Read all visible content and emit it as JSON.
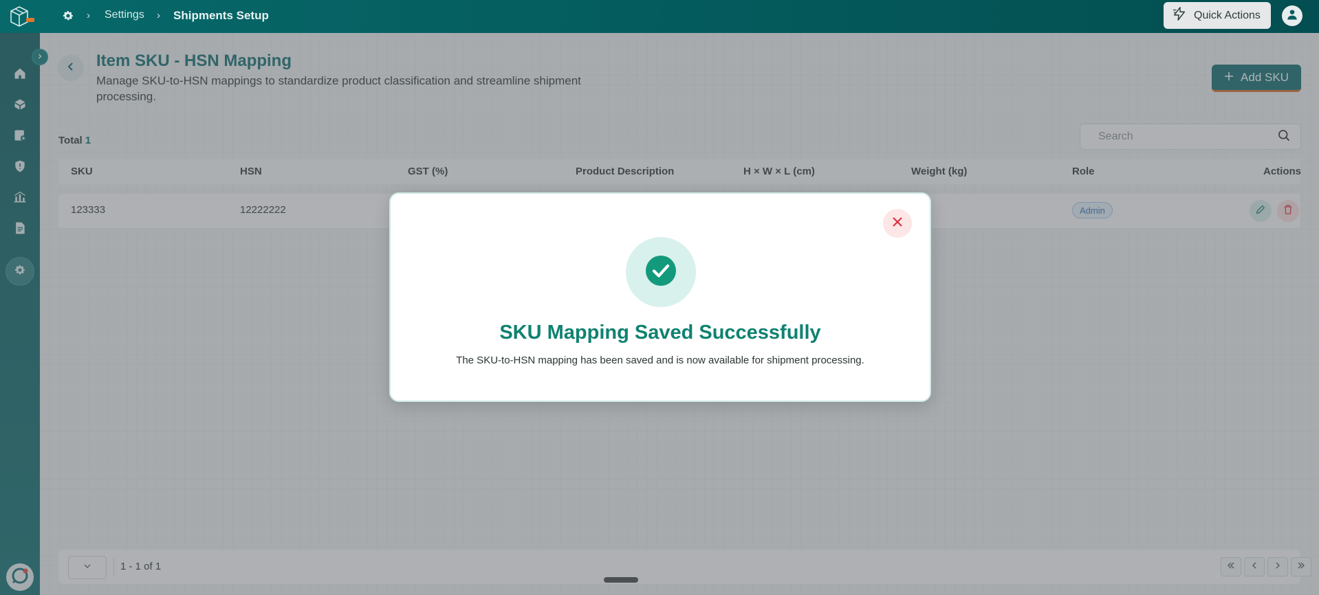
{
  "breadcrumb": {
    "items": [
      "Settings",
      "Shipments Setup"
    ]
  },
  "header": {
    "quick_actions_label": "Quick Actions"
  },
  "page": {
    "title": "Item SKU - HSN Mapping",
    "description": "Manage SKU-to-HSN mappings to standardize product classification and streamline shipment processing.",
    "add_button_label": "Add SKU",
    "total_label": "Total",
    "total_count": "1"
  },
  "search": {
    "placeholder": "Search"
  },
  "table": {
    "columns": [
      "SKU",
      "HSN",
      "GST (%)",
      "Product Description",
      "H × W × L (cm)",
      "Weight (kg)",
      "Role",
      "Actions"
    ],
    "rows": [
      {
        "sku": "123333",
        "hsn": "12222222",
        "role": "Admin"
      }
    ]
  },
  "pagination": {
    "info": "1 - 1 of 1"
  },
  "modal": {
    "title": "SKU Mapping Saved Successfully",
    "message": "The SKU-to-HSN mapping has been saved and is now available for shipment processing."
  },
  "colors": {
    "primary": "#0a6b6b",
    "success": "#108270",
    "danger": "#d9333f",
    "accent": "#d86b2a"
  }
}
